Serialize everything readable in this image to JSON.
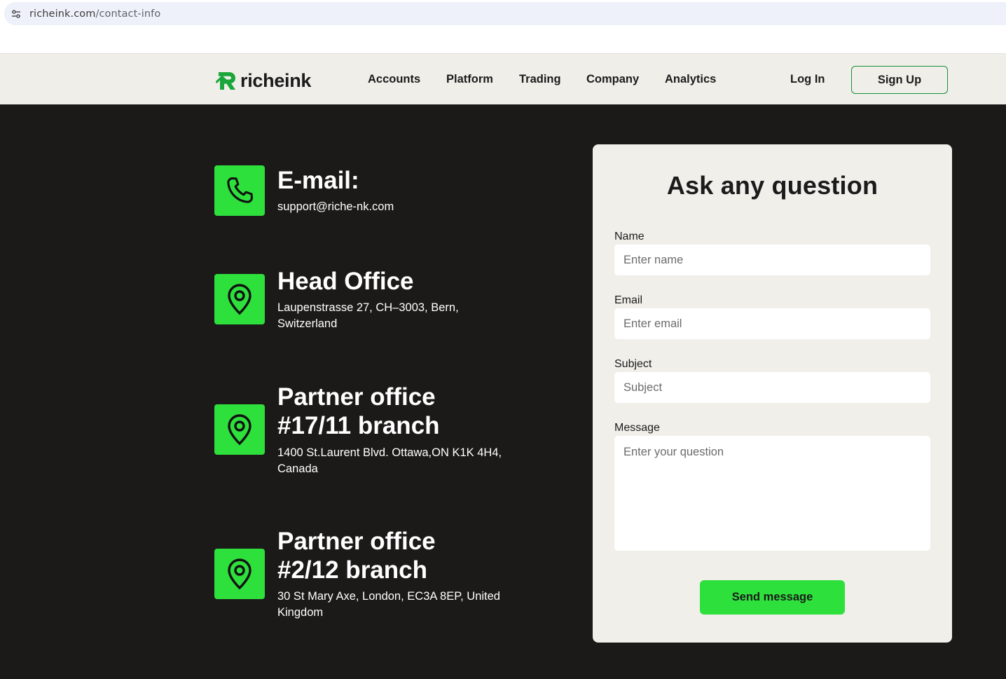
{
  "browser": {
    "url_host": "richeink.com",
    "url_path": "/contact-info",
    "site_info_icon": "tune-icon"
  },
  "header": {
    "logo_text": "richeink",
    "logo_icon": "logo-mark",
    "nav": [
      "Accounts",
      "Platform",
      "Trading",
      "Company",
      "Analytics"
    ],
    "login_label": "Log In",
    "signup_label": "Sign Up"
  },
  "contacts": [
    {
      "icon": "phone-icon",
      "title": "E-mail:",
      "text": "support@riche-nk.com"
    },
    {
      "icon": "location-pin-icon",
      "title": "Head Office",
      "text": "Laupenstrasse 27, CH–3003, Bern, Switzerland"
    },
    {
      "icon": "location-pin-icon",
      "title_line1": "Partner office",
      "title_line2": "#17/11 branch",
      "text": "1400 St.Laurent Blvd. Ottawa,ON K1K 4H4, Canada"
    },
    {
      "icon": "location-pin-icon",
      "title_line1": "Partner office",
      "title_line2": "#2/12 branch",
      "text": "30 St Mary Axe, London, EC3A 8EP, United Kingdom"
    }
  ],
  "form": {
    "title": "Ask any question",
    "name_label": "Name",
    "name_placeholder": "Enter name",
    "email_label": "Email",
    "email_placeholder": "Enter email",
    "subject_label": "Subject",
    "subject_placeholder": "Subject",
    "message_label": "Message",
    "message_placeholder": "Enter your question",
    "submit_label": "Send message"
  },
  "colors": {
    "accent": "#2ee03c",
    "dark_bg": "#1c1a19",
    "header_bg": "#efeee8",
    "card_bg": "#f0efea"
  }
}
